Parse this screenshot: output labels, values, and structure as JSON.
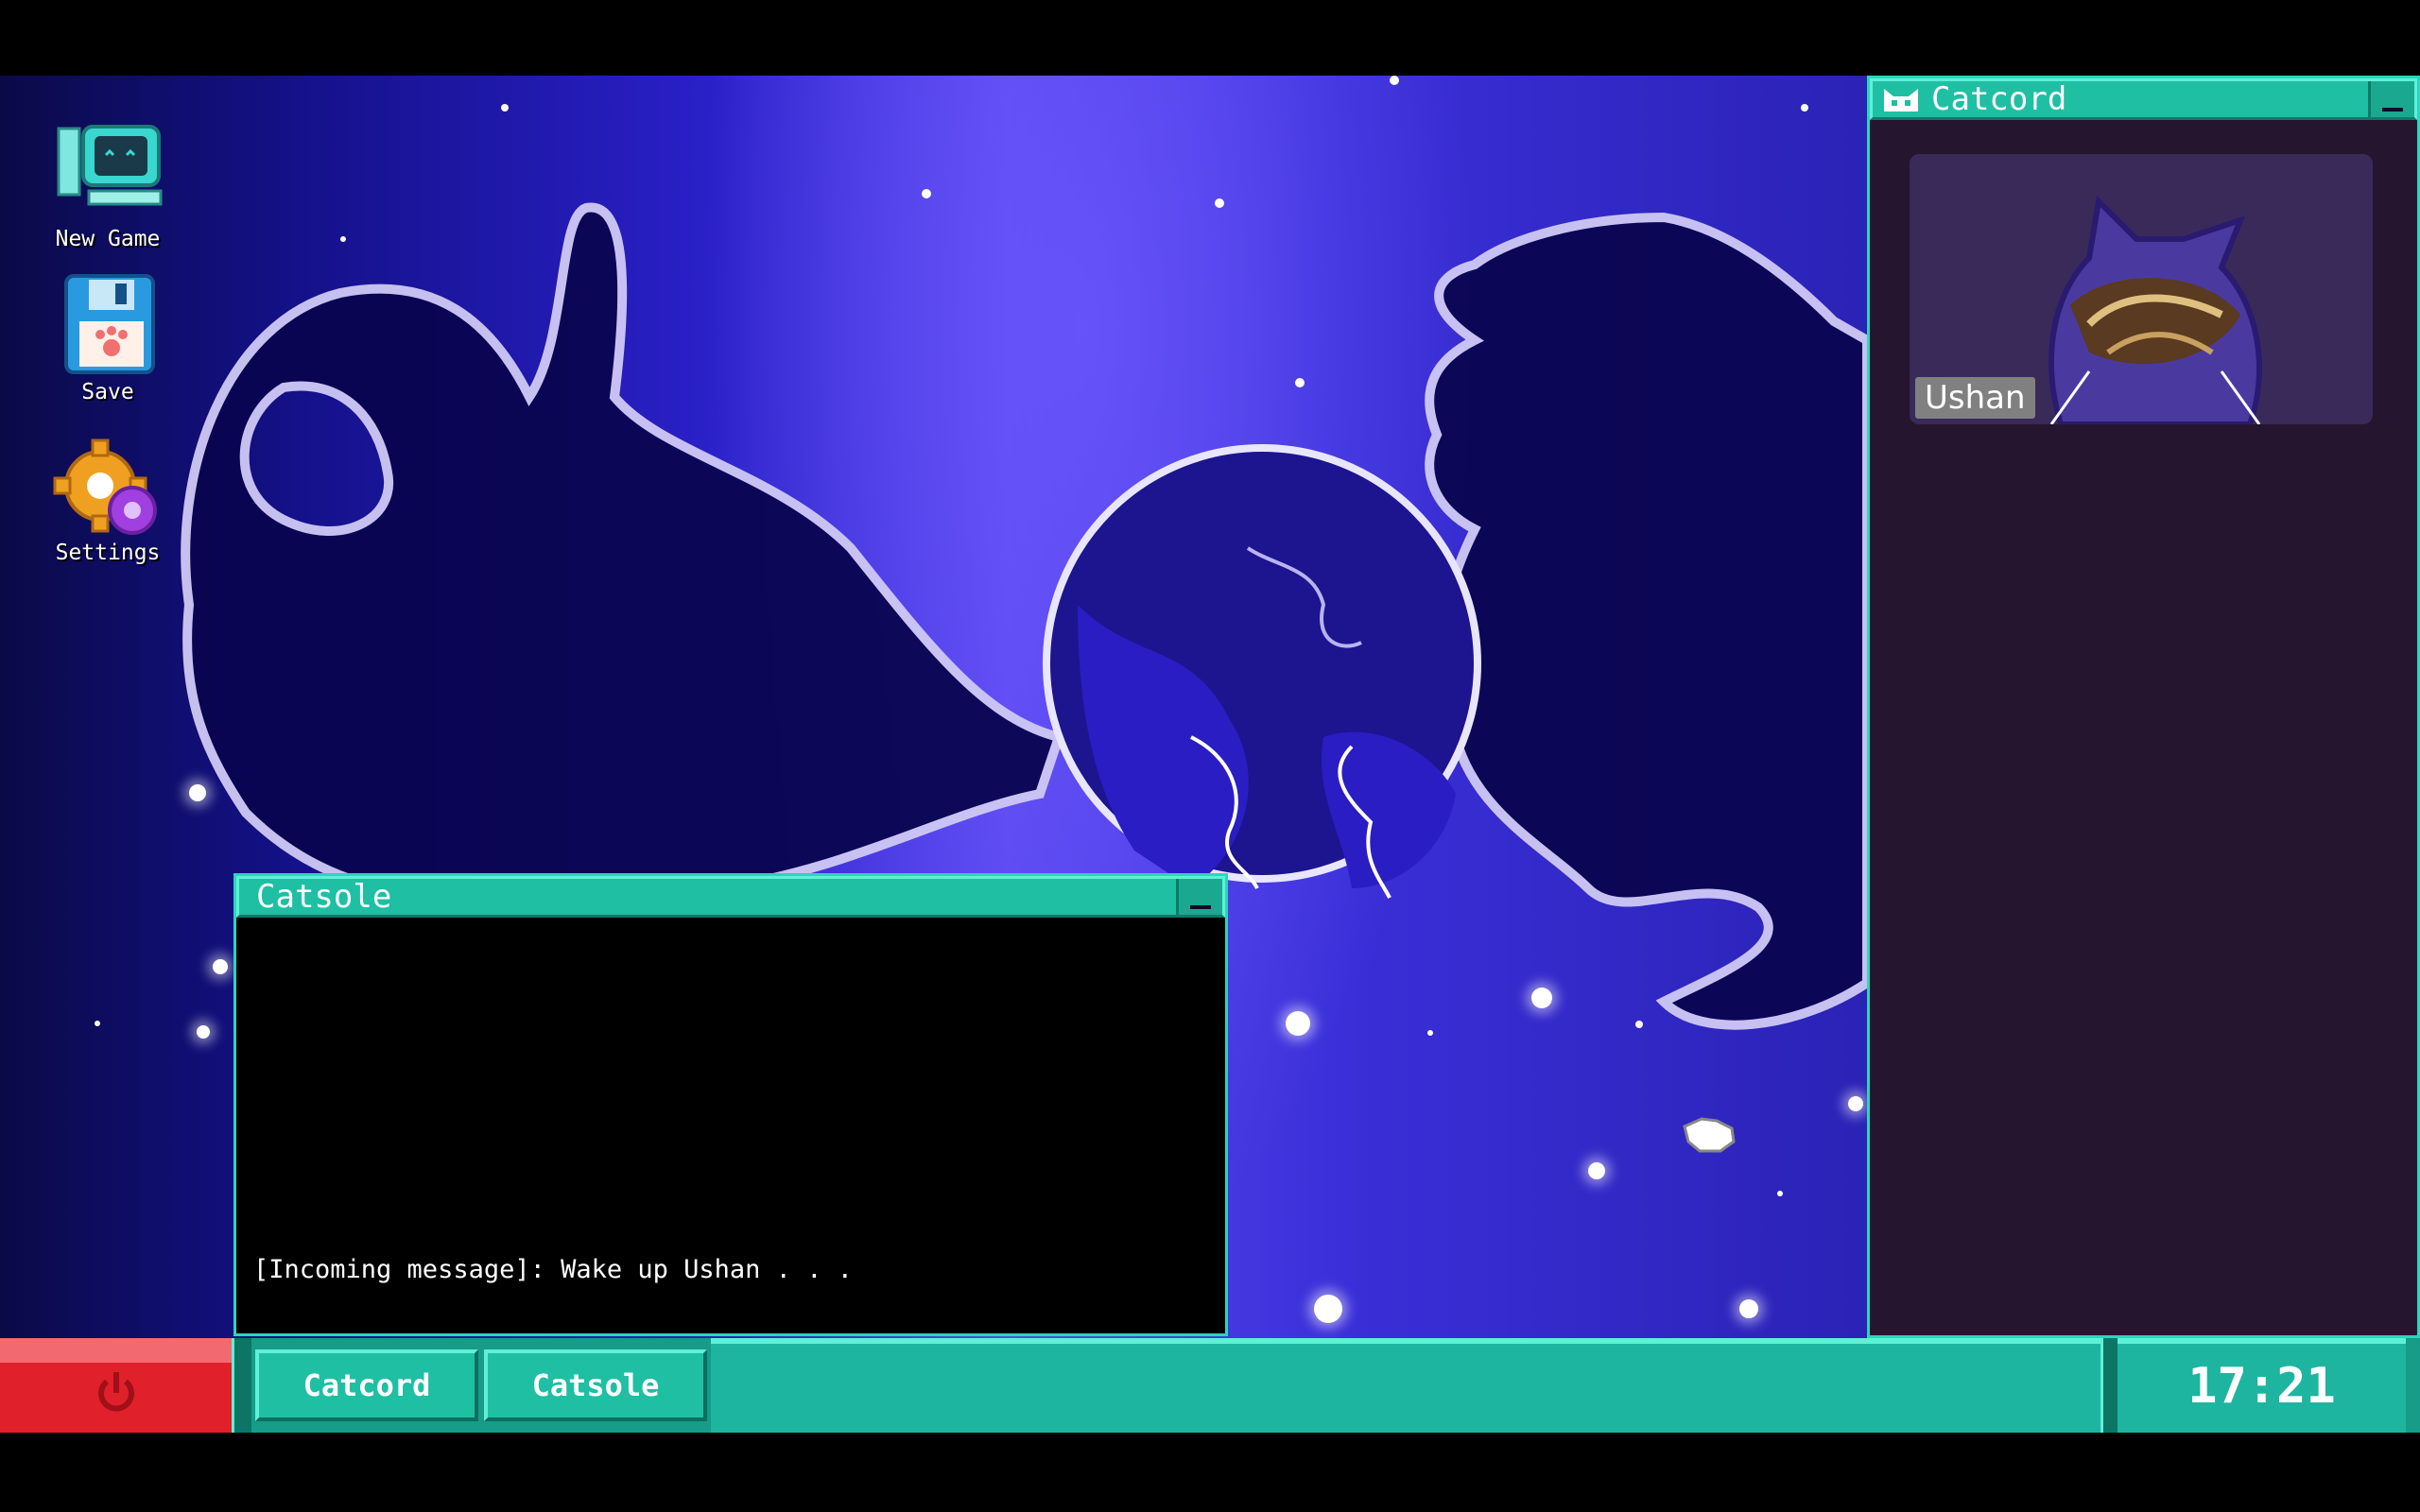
{
  "desktop": {
    "icons": [
      {
        "label": "New Game"
      },
      {
        "label": "Save"
      },
      {
        "label": "Settings"
      }
    ]
  },
  "catsole": {
    "title": "Catsole",
    "message": "[Incoming message]: Wake up Ushan . . ."
  },
  "catcord": {
    "title": "Catcord",
    "contact_name": "Ushan"
  },
  "taskbar": {
    "buttons": [
      {
        "label": "Catcord"
      },
      {
        "label": "Catsole"
      }
    ],
    "clock": "17:21"
  },
  "colors": {
    "window_teal": "#1fbfa4",
    "power_red": "#e0202a",
    "catcord_bg": "#26152e"
  }
}
